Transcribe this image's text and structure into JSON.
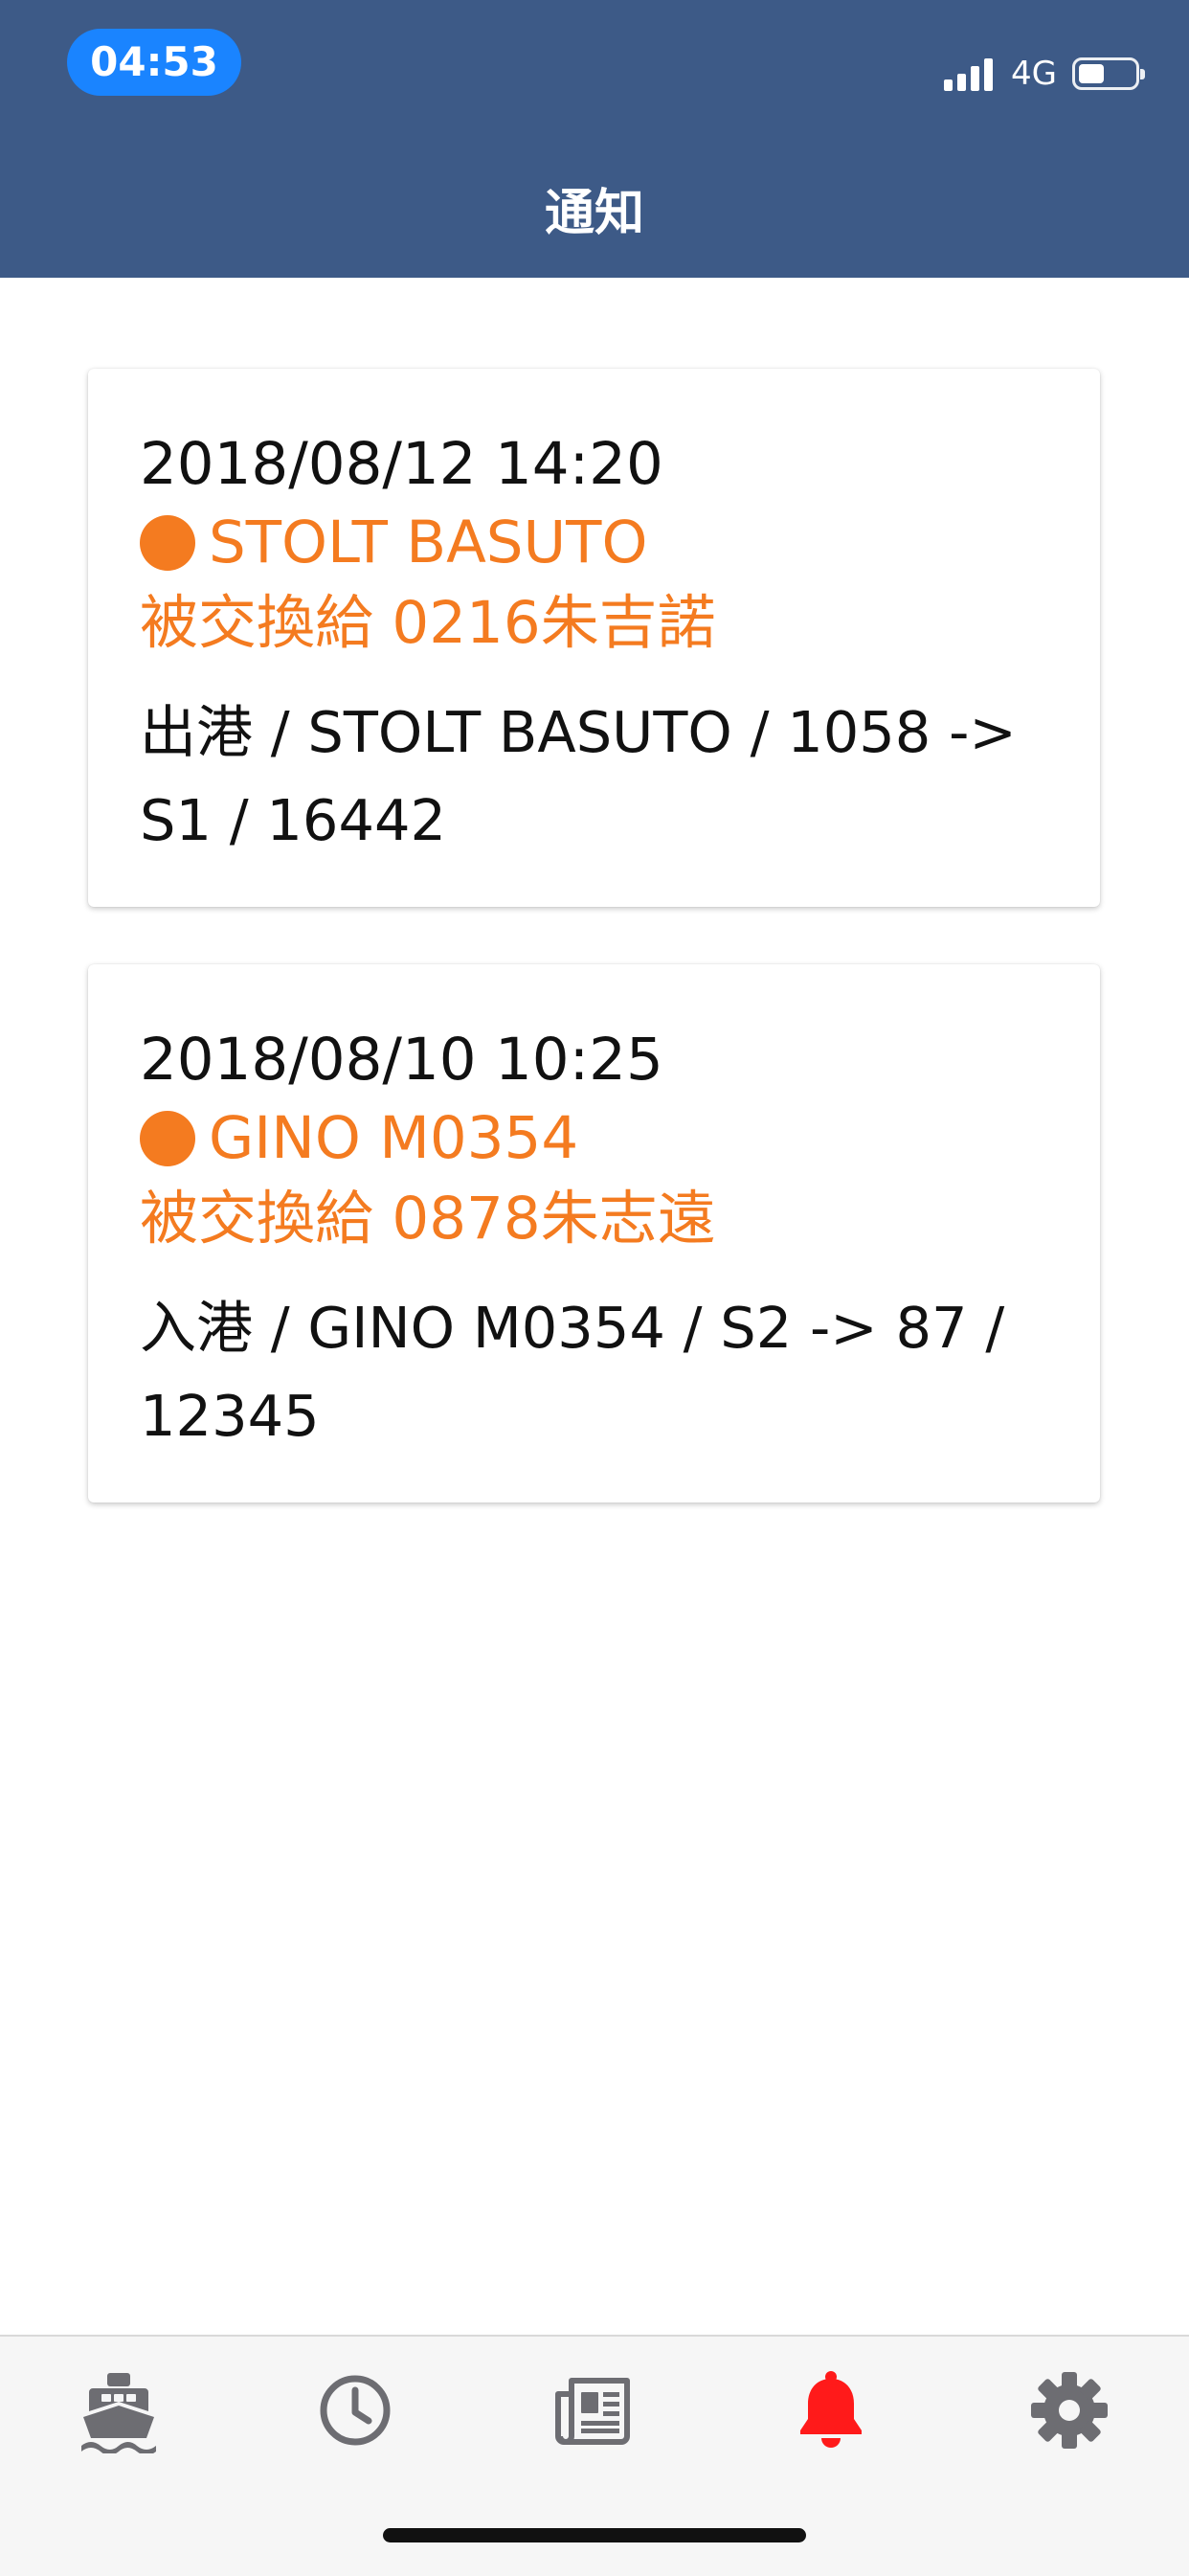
{
  "status_bar": {
    "time": "04:53",
    "network": "4G"
  },
  "header": {
    "title": "通知"
  },
  "notifications": [
    {
      "datetime": "2018/08/12 14:20",
      "ship": "STOLT BASUTO",
      "transfer": "被交換給 0216朱吉諾",
      "detail": "出港 / STOLT BASUTO / 1058 -> S1 / 16442"
    },
    {
      "datetime": "2018/08/10 10:25",
      "ship": "GINO M0354",
      "transfer": "被交換給 0878朱志遠",
      "detail": "入港 / GINO M0354 / S2 -> 87 / 12345"
    }
  ],
  "tabbar": {
    "tabs": [
      {
        "icon": "ship-icon",
        "active": false
      },
      {
        "icon": "clock-icon",
        "active": false
      },
      {
        "icon": "newspaper-icon",
        "active": false
      },
      {
        "icon": "bell-icon",
        "active": true
      },
      {
        "icon": "gear-icon",
        "active": false
      }
    ],
    "active_color": "#ff1a1a",
    "inactive_color": "#6d6d72"
  },
  "colors": {
    "header_bg": "#3d5a87",
    "accent_orange": "#f47b20",
    "time_pill": "#1a84ff"
  }
}
